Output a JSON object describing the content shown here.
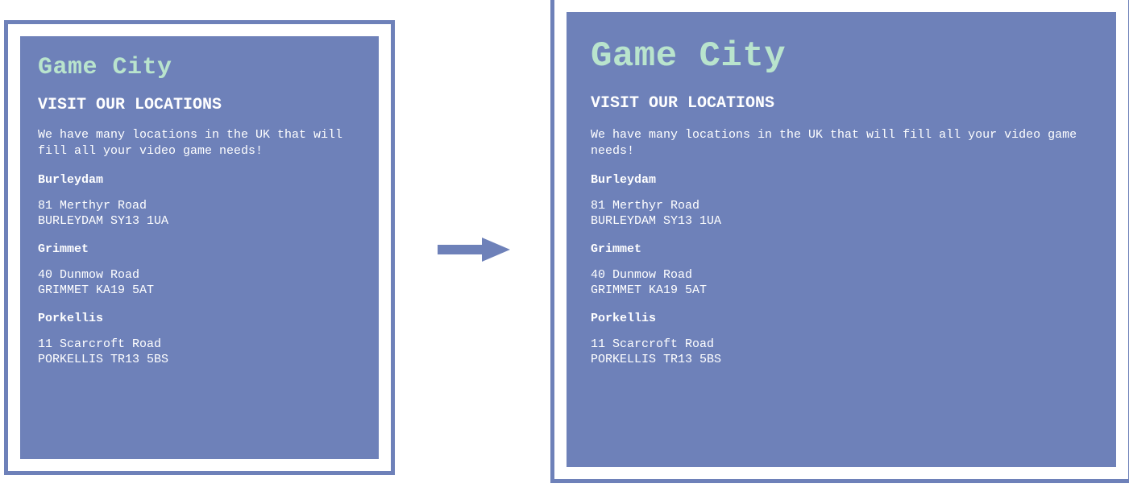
{
  "brand": "Game City",
  "heading": "VISIT OUR LOCATIONS",
  "intro": "We have many locations in the UK that will fill all your video game needs!",
  "locations": [
    {
      "name": "Burleydam",
      "address": "81 Merthyr Road\nBURLEYDAM SY13 1UA"
    },
    {
      "name": "Grimmet",
      "address": "40 Dunmow Road\nGRIMMET KA19 5AT"
    },
    {
      "name": "Porkellis",
      "address": "11 Scarcroft Road\nPORKELLIS TR13 5BS"
    }
  ],
  "colors": {
    "panel": "#6e81b9",
    "accent": "#b9e4cd",
    "text": "#ffffff"
  }
}
